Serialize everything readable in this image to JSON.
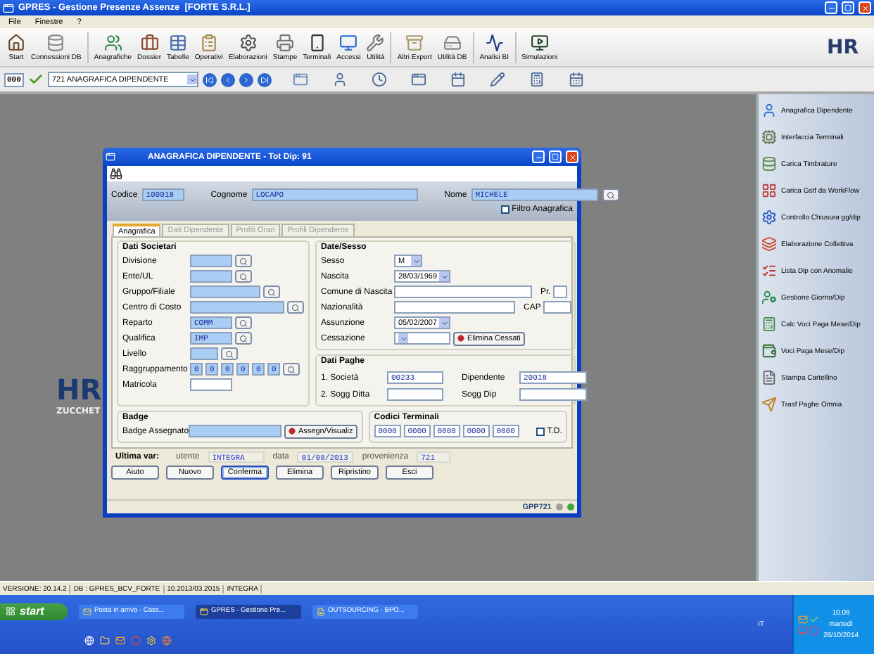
{
  "window": {
    "title": "GPRES - Gestione Presenze Assenze  [FORTE S.R.L.]"
  },
  "menu": [
    "File",
    "Finestre",
    "?"
  ],
  "toolbar": [
    {
      "label": "Start"
    },
    {
      "label": "Connessioni DB"
    },
    {
      "label": "Anagrafiche"
    },
    {
      "label": "Dossier"
    },
    {
      "label": "Tabelle"
    },
    {
      "label": "Operativi"
    },
    {
      "label": "Elaborazioni"
    },
    {
      "label": "Stampe"
    },
    {
      "label": "Terminali"
    },
    {
      "label": "Accessi"
    },
    {
      "label": "Utilità"
    },
    {
      "label": "Altri Export"
    },
    {
      "label": "Utilità DB"
    },
    {
      "label": "Analisi BI"
    },
    {
      "label": "Simulazioni"
    }
  ],
  "brand": "HR",
  "navigator": {
    "code": "000",
    "selection": "721 ANAGRAFICA DIPENDENTE"
  },
  "background_logo": {
    "mark": "HR",
    "text": "ZUCCHET"
  },
  "sidebar": {
    "items": [
      "Anagrafica Dipendente",
      "Interfaccia Terminali",
      "Carica Timbrature",
      "Carica Gstf da WorkFlow",
      "Controllo Chiusura gg/dip",
      "Elaborazione Collettiva",
      "Lista Dip con Anomalie",
      "Gestione Giorno/Dip",
      "Calc Voci Paga Mese/Dip",
      "Voci Paga Mese/Dip",
      "Stampa Cartellino",
      "Trasf Paghe Omnia"
    ]
  },
  "dialog": {
    "title": "ANAGRAFICA DIPENDENTE - Tot Dip: 91",
    "header": [
      {
        "label": "Codice",
        "value": "100018"
      },
      {
        "label": "Cognome",
        "value": "LOCAPO"
      },
      {
        "label": "Nome",
        "value": "MICHELE"
      }
    ],
    "filter": {
      "label": "Filtro Anagrafica",
      "checked": false
    },
    "tabs": [
      {
        "label": "Anagrafica",
        "selected": true
      },
      {
        "label": "Dati Dipendente",
        "selected": false
      },
      {
        "label": "Profili Orari",
        "selected": false
      },
      {
        "label": "Profili Dipendente",
        "selected": false
      }
    ],
    "company": {
      "title": "Dati Societari",
      "rows": [
        {
          "kind": "lookup",
          "label": "Divisione"
        },
        {
          "kind": "lookup",
          "label": "Ente/UL"
        },
        {
          "kind": "lookup",
          "label": "Gruppo/Filiale"
        },
        {
          "kind": "lookup",
          "label": "Centro di Costo"
        },
        {
          "kind": "lookup",
          "label": "Reparto",
          "value": "COMM"
        },
        {
          "kind": "lookup",
          "label": "Qualifica",
          "value": "IMP"
        },
        {
          "kind": "lookup",
          "label": "Livello"
        },
        {
          "kind": "segments",
          "label": "Raggruppamento",
          "values": [
            "0",
            "0",
            "0",
            "0",
            "0",
            "0"
          ]
        },
        {
          "kind": "text",
          "label": "Matricola"
        }
      ]
    },
    "personal": {
      "title": "Date/Sesso",
      "rows": [
        {
          "kind": "select",
          "label": "Sesso",
          "value": "M"
        },
        {
          "kind": "select",
          "label": "Nascita",
          "value": "28/03/1969"
        },
        {
          "kind": "text",
          "label": "Comune di Nascita",
          "extra": "Pr."
        },
        {
          "kind": "text",
          "label": "Nazionalità",
          "extra": "CAP"
        },
        {
          "kind": "select",
          "label": "Assunzione",
          "value": "05/02/2007"
        },
        {
          "kind": "select",
          "label": "Cessazione",
          "action": "Elimina Cessati"
        }
      ]
    },
    "payroll": {
      "title": "Dati Paghe",
      "fields": [
        {
          "label": "1. Società",
          "value": "00233"
        },
        {
          "label": "Dipendente",
          "value": "20018"
        },
        {
          "label": "2. Sogg Ditta"
        },
        {
          "label": "Sogg Dip"
        }
      ]
    },
    "badge": {
      "title": "Badge",
      "label": "Badge Assegnato",
      "action": "Assegn/Visualiz"
    },
    "terminals": {
      "title": "Codici Terminali",
      "codes": [
        "0000",
        "0000",
        "0000",
        "0000",
        "0000"
      ],
      "td": {
        "label": "T.D.",
        "checked": false
      }
    },
    "last_change": {
      "label": "Ultima var:",
      "fields": [
        {
          "label": "utente",
          "value": "INTEGRA"
        },
        {
          "label": "data",
          "value": "01/08/2013"
        },
        {
          "label": "provenienza",
          "value": "721"
        }
      ]
    },
    "buttons": [
      {
        "label": "Aiuto",
        "focused": false
      },
      {
        "label": "Nuovo",
        "focused": false
      },
      {
        "label": "Conferma",
        "focused": true
      },
      {
        "label": "Elimina",
        "focused": false
      },
      {
        "label": "Ripristino",
        "focused": false
      },
      {
        "label": "Esci",
        "focused": false
      }
    ],
    "status": "GPP721"
  },
  "status_bar": [
    "VERSIONE: 20.14.2",
    "DB : GPRES_BCV_FORTE",
    "10.2013/03.2015",
    "INTEGRA"
  ],
  "taskbar": {
    "start": "start",
    "tasks": [
      {
        "label": "Posta in arrivo - Cass...",
        "selected": false
      },
      {
        "label": "GPRES - Gestione Pre...",
        "selected": true
      },
      {
        "label": "OUTSOURCING - BPO...",
        "selected": false
      }
    ],
    "language": "IT",
    "time": "10.09",
    "day": "martedì",
    "date": "28/10/2014"
  }
}
